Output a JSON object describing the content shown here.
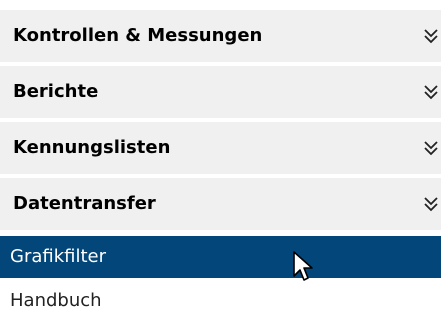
{
  "menu": {
    "sections": [
      {
        "label": "Kontrollen & Messungen",
        "icon": "double-chevron-down-icon"
      },
      {
        "label": "Berichte",
        "icon": "double-chevron-down-icon"
      },
      {
        "label": "Kennungslisten",
        "icon": "double-chevron-down-icon"
      },
      {
        "label": "Datentransfer",
        "icon": "double-chevron-down-icon"
      }
    ],
    "items": [
      {
        "label": "Grafikfilter",
        "selected": true
      },
      {
        "label": "Handbuch",
        "selected": false
      }
    ]
  },
  "colors": {
    "header_bg": "#f0f0f0",
    "selected_bg": "#03467a",
    "selected_text": "#ffffff"
  },
  "cursor": {
    "icon": "mouse-pointer-icon"
  }
}
